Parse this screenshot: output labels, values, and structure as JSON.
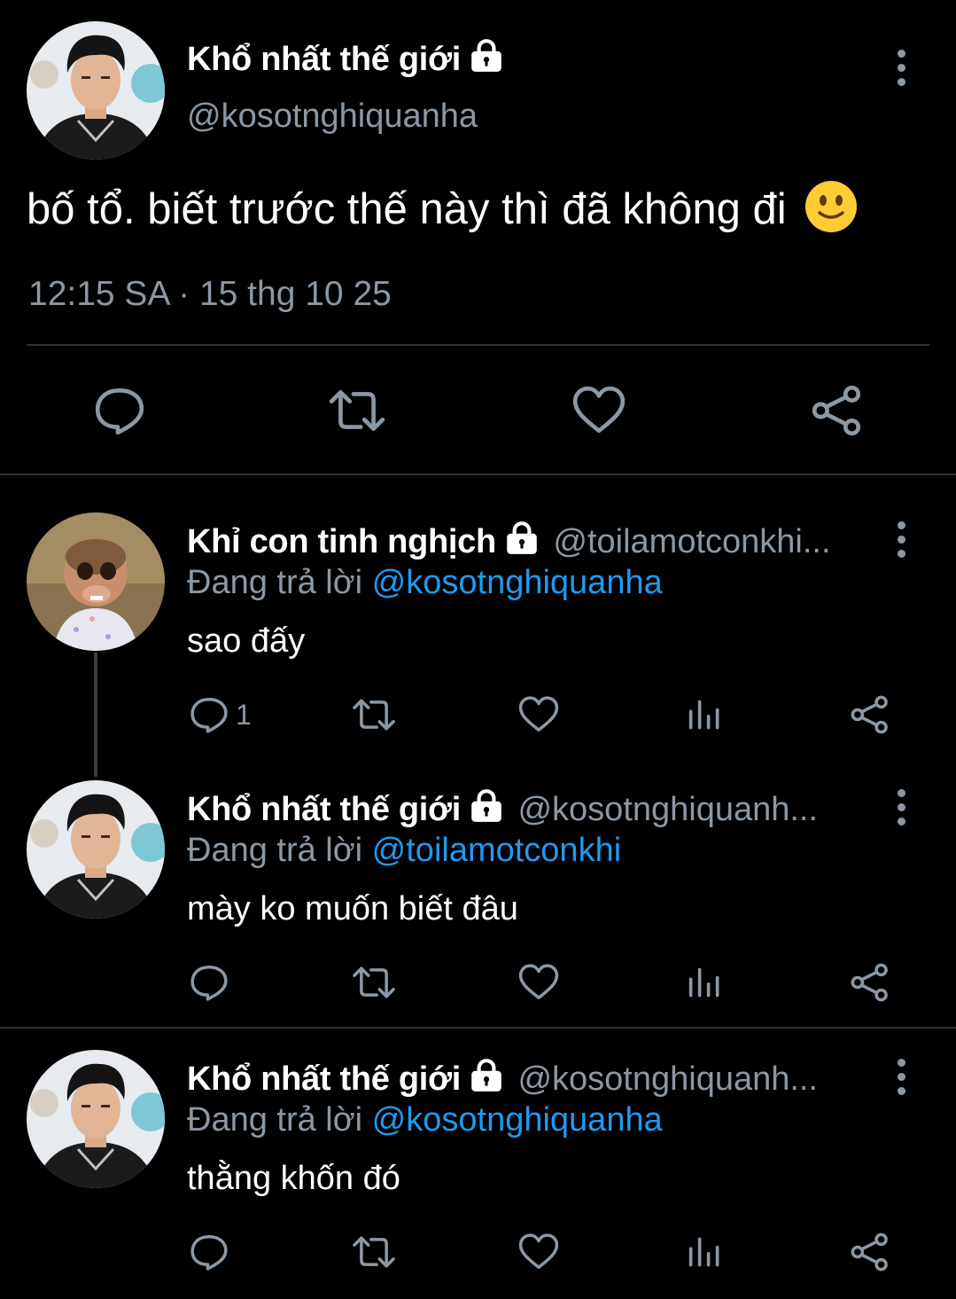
{
  "main_tweet": {
    "display_name": "Khổ nhất thế giới",
    "handle": "@kosotnghiquanha",
    "text": "bố tổ. biết trước thế này thì đã không đi",
    "emoji": "🙂",
    "timestamp": "12:15 SA · 15 thg 10 25",
    "locked": true
  },
  "replies": [
    {
      "display_name": "Khỉ con tinh nghịch",
      "handle": "@toilamotconkhi...",
      "replying_prefix": "Đang trả lời",
      "replying_to": "@kosotnghiquanha",
      "text": "sao đấy",
      "reply_count": "1",
      "avatar": "monkey-avatar"
    },
    {
      "display_name": "Khổ nhất thế giới",
      "handle": "@kosotnghiquanh...",
      "replying_prefix": "Đang trả lời",
      "replying_to": "@toilamotconkhi",
      "text": "mày ko muốn biết đâu",
      "reply_count": "",
      "avatar": "man-avatar"
    },
    {
      "display_name": "Khổ nhất thế giới",
      "handle": "@kosotnghiquanh...",
      "replying_prefix": "Đang trả lời",
      "replying_to": "@kosotnghiquanha",
      "text": "thằng khốn đó",
      "reply_count": "",
      "avatar": "man-avatar"
    }
  ],
  "colors": {
    "background": "#000000",
    "text": "#ffffff",
    "secondary": "#8b98a5",
    "link": "#1d9bf0",
    "divider": "#2f3336"
  }
}
